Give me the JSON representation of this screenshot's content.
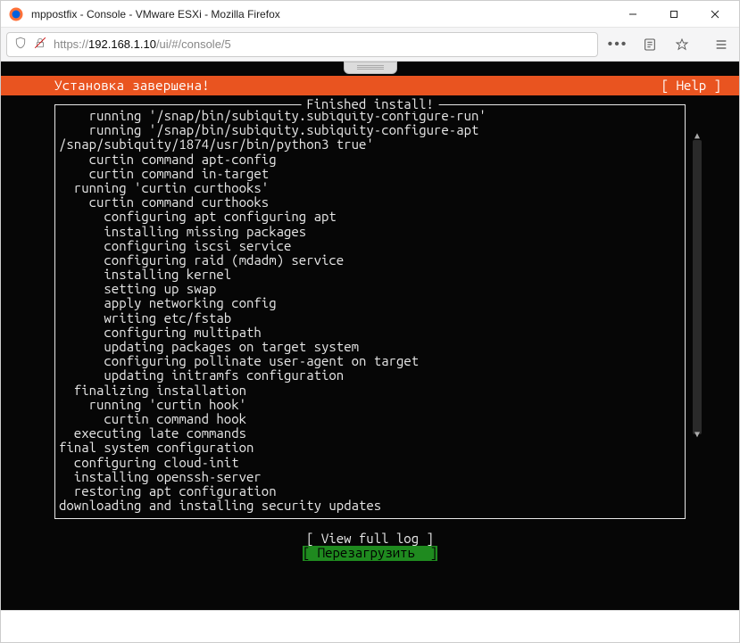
{
  "window": {
    "title": "mppostfix - Console - VMware ESXi - Mozilla Firefox"
  },
  "addressbar": {
    "protocol": "https://",
    "host": "192.168.1.10",
    "path": "/ui/#/console/5"
  },
  "console": {
    "header": {
      "left": "Установка завершена!",
      "right": "[ Help ]"
    },
    "box_title": "Finished install!",
    "log": "    running '/snap/bin/subiquity.subiquity-configure-run'\n    running '/snap/bin/subiquity.subiquity-configure-apt\n/snap/subiquity/1874/usr/bin/python3 true'\n    curtin command apt-config\n    curtin command in-target\n  running 'curtin curthooks'\n    curtin command curthooks\n      configuring apt configuring apt\n      installing missing packages\n      configuring iscsi service\n      configuring raid (mdadm) service\n      installing kernel\n      setting up swap\n      apply networking config\n      writing etc/fstab\n      configuring multipath\n      updating packages on target system\n      configuring pollinate user-agent on target\n      updating initramfs configuration\n  finalizing installation\n    running 'curtin hook'\n      curtin command hook\n  executing late commands\nfinal system configuration\n  configuring cloud-init\n  installing openssh-server\n  restoring apt configuration\ndownloading and installing security updates",
    "options": {
      "view_log": "[ View full log ]",
      "reboot": "[ Перезагрузить  ]"
    }
  }
}
